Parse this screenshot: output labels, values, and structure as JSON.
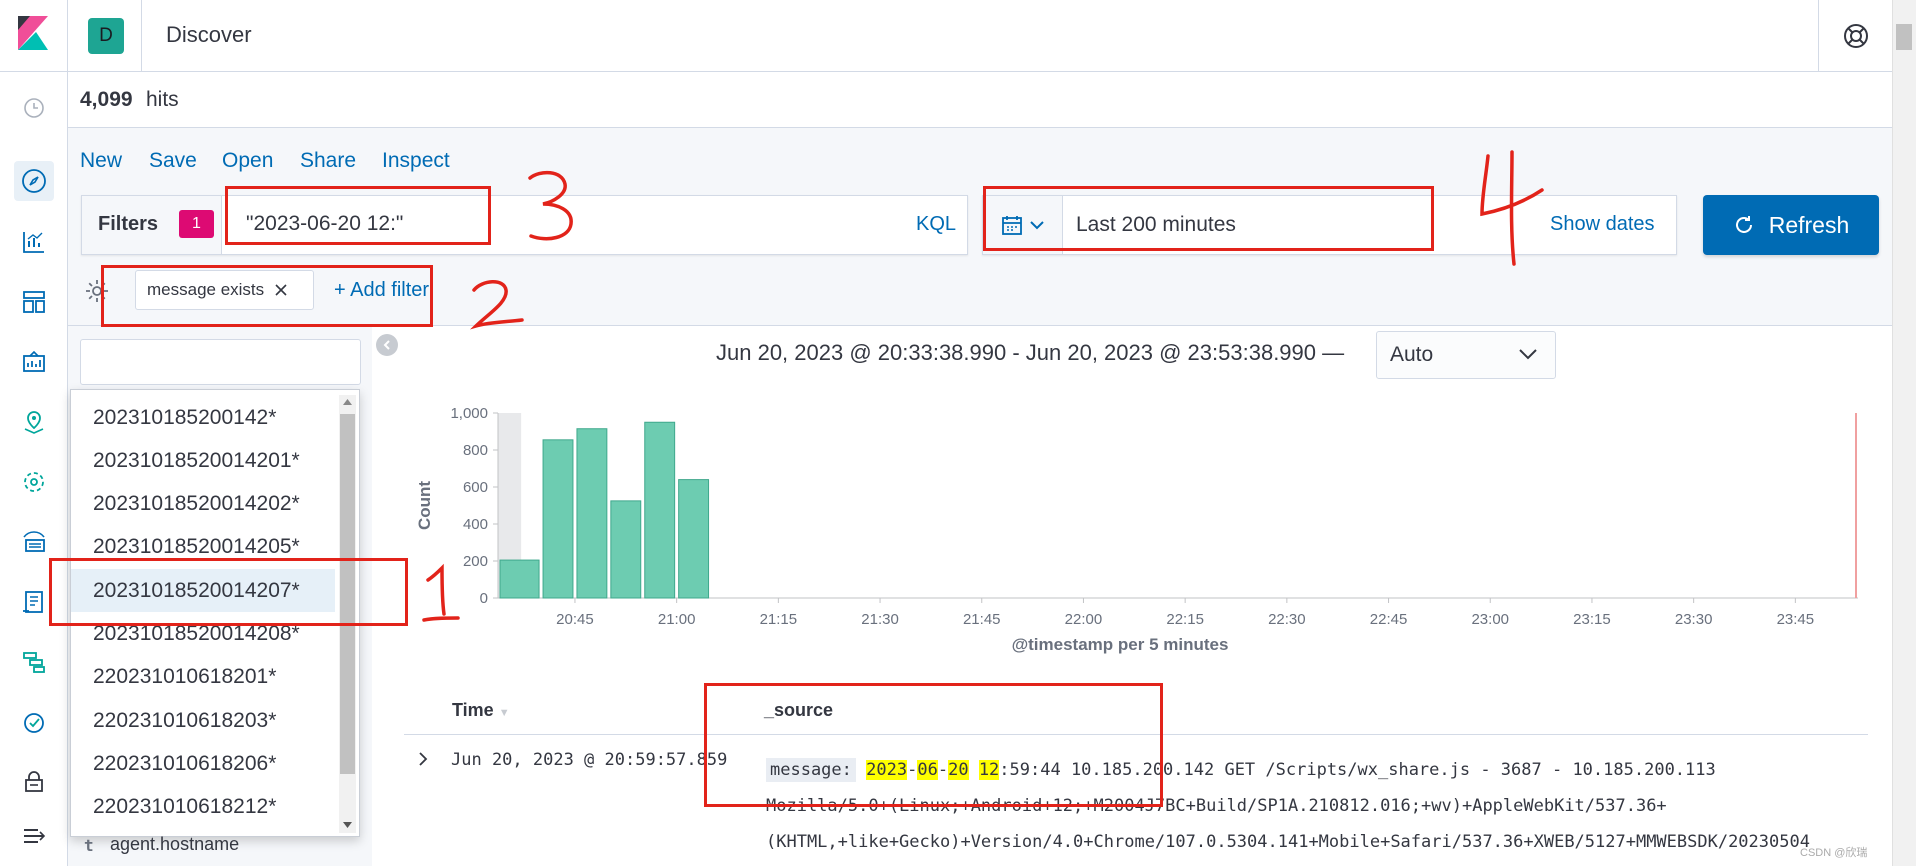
{
  "header": {
    "space_initial": "D",
    "app_title": "Discover"
  },
  "hits": {
    "count": "4,099",
    "label": "hits"
  },
  "menu": {
    "new": "New",
    "save": "Save",
    "open": "Open",
    "share": "Share",
    "inspect": "Inspect"
  },
  "query": {
    "filters_label": "Filters",
    "filters_count": "1",
    "value": "\"2023-06-20 12:\"",
    "language": "KQL"
  },
  "time": {
    "quick_value": "Last 200 minutes",
    "show_dates": "Show dates",
    "refresh_label": "Refresh"
  },
  "filter_bar": {
    "pill_label": "message exists",
    "add_filter": "+ Add filter"
  },
  "index_patterns": {
    "selected": "2023101852001420 7*",
    "options": [
      "202310185200142*",
      "2023101852001420 1*",
      "2023101852001420 2*",
      "2023101852001420 5*",
      "2023101852001420 7*",
      "2023101852001420 8*",
      "220231010618201*",
      "220231010618203*",
      "220231010618206*",
      "220231010618212*"
    ]
  },
  "field_list": {
    "first_field_type": "t",
    "first_field_name": "agent.hostname"
  },
  "chart": {
    "range_text": "Jun 20, 2023 @ 20:33:38.990 - Jun 20, 2023 @ 23:53:38.990 —",
    "interval": "Auto"
  },
  "chart_data": {
    "type": "bar",
    "xlabel": "@timestamp per 5 minutes",
    "ylabel": "Count",
    "ylim": [
      0,
      1000
    ],
    "yticks": [
      "0",
      "200",
      "400",
      "600",
      "800",
      "1,000"
    ],
    "xticks": [
      "20:45",
      "21:00",
      "21:15",
      "21:30",
      "21:45",
      "22:00",
      "22:15",
      "22:30",
      "22:45",
      "23:00",
      "23:15",
      "23:30",
      "23:45"
    ],
    "categories": [
      "20:35",
      "20:40",
      "20:45",
      "20:50",
      "20:55",
      "21:00"
    ],
    "values": [
      205,
      855,
      915,
      525,
      950,
      640
    ],
    "bar_color": "#6dccb1",
    "grid": false
  },
  "table": {
    "col_time": "Time",
    "col_source": "_source",
    "row": {
      "time": "Jun 20, 2023 @ 20:59:57.859",
      "message_key": "message:",
      "message_parts": [
        "2023",
        "-",
        "06",
        "-",
        "20",
        " ",
        "12"
      ],
      "message_rest": ":59:44 10.185.200.142 GET /Scripts/wx_share.js - 3687 - 10.185.200.113",
      "line2": "Mozilla/5.0+(Linux;+Android+12;+M2004J7BC+Build/SP1A.210812.016;+wv)+AppleWebKit/537.36+",
      "line3": "(KHTML,+like+Gecko)+Version/4.0+Chrome/107.0.5304.141+Mobile+Safari/537.36+XWEB/5127+MMWEBSDK/20230504"
    }
  },
  "annotations": {
    "colors": {
      "red": "#e2231a"
    }
  },
  "watermark": "CSDN @欣瑞"
}
